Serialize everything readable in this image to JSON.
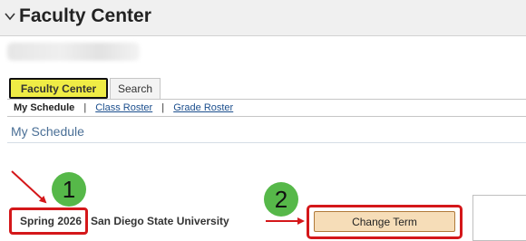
{
  "header": {
    "title": "Faculty Center",
    "collapse_icon": "chevron-down-icon"
  },
  "tabs": [
    {
      "label": "Faculty Center",
      "active": true
    },
    {
      "label_prefix": "Search",
      "label_underlined": ""
    }
  ],
  "subnav": {
    "current": "My Schedule",
    "links": [
      "Class Roster",
      "Grade Roster"
    ],
    "separator": "|"
  },
  "section_title": "My Schedule",
  "term": {
    "label": "Spring 2026",
    "institution": "San Diego State University"
  },
  "change_term_button": "Change Term",
  "annotations": {
    "callout_1": "1",
    "callout_2": "2"
  },
  "colors": {
    "active_tab": "#efec45",
    "highlight_box": "#d4171a",
    "callout": "#56b849",
    "button": "#f6ddb8",
    "link": "#1b4e8d",
    "section_title": "#4a6f96"
  }
}
